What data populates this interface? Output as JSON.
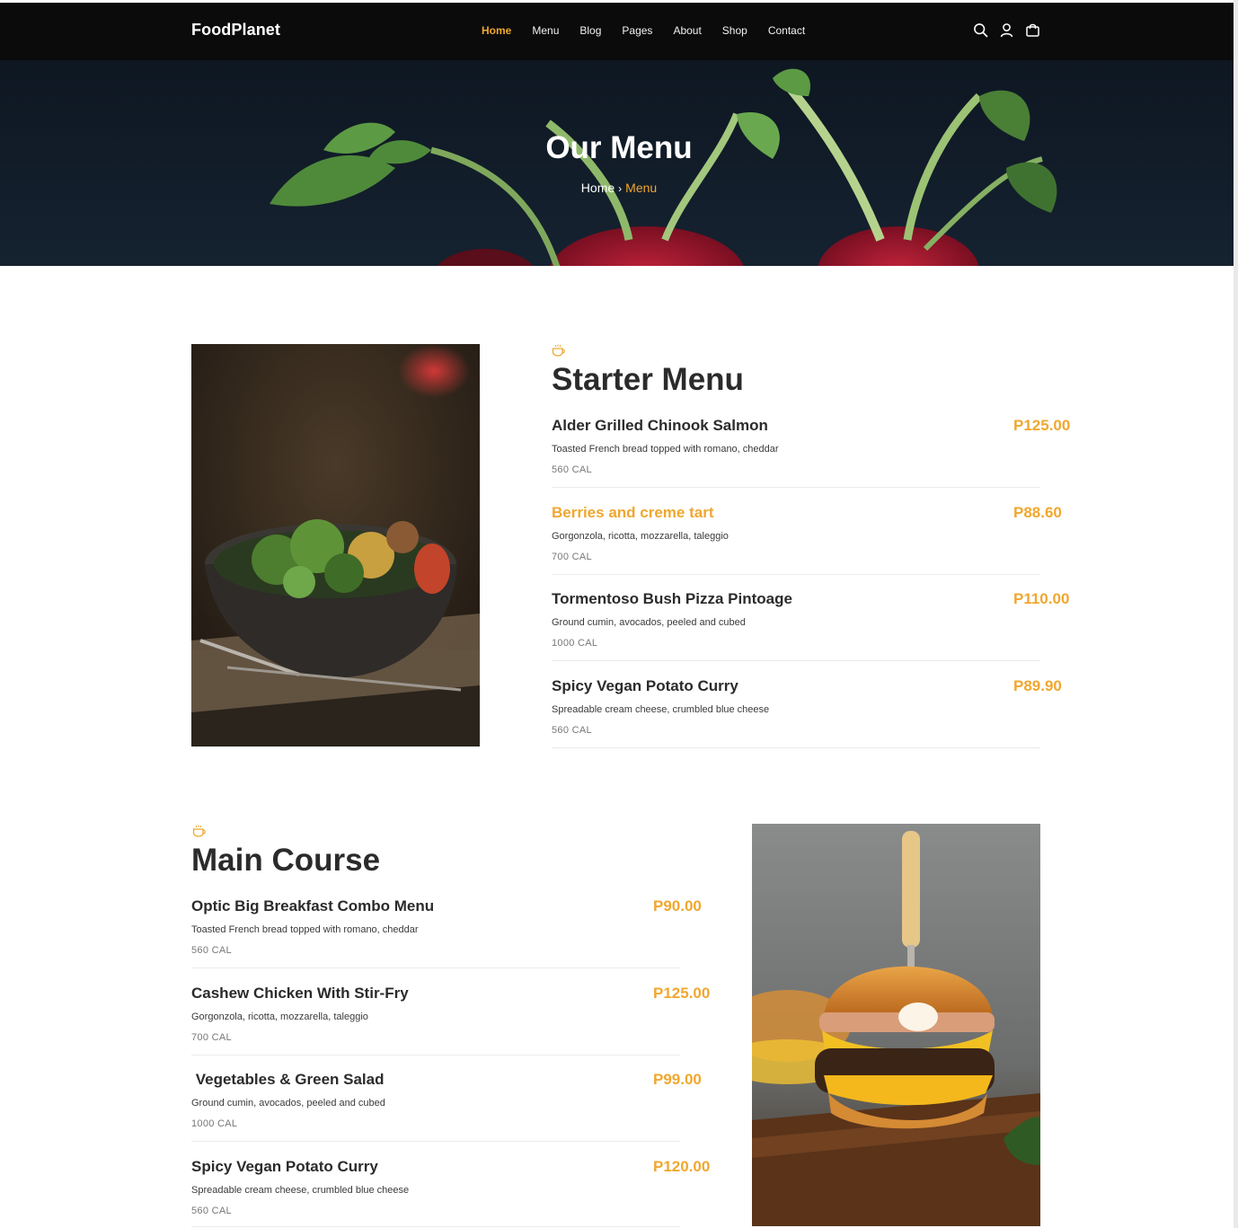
{
  "brand": {
    "name": "FoodPlanet",
    "accent": "#f0a72f",
    "navbar_bg": "#0b0b0b"
  },
  "nav": {
    "items": [
      {
        "label": "Home",
        "active": true
      },
      {
        "label": "Menu"
      },
      {
        "label": "Blog"
      },
      {
        "label": "Pages"
      },
      {
        "label": "About"
      },
      {
        "label": "Shop"
      },
      {
        "label": "Contact"
      }
    ],
    "icons": [
      "search-icon",
      "user-icon",
      "shopping-bag-icon"
    ]
  },
  "hero": {
    "title": "Our Menu",
    "breadcrumb": {
      "home": "Home",
      "separator": "›",
      "current": "Menu"
    }
  },
  "starter": {
    "icon": "coffee-cup-icon",
    "title": "Starter Menu",
    "items": [
      {
        "name": "Alder Grilled Chinook Salmon",
        "price": "P125.00",
        "desc": "Toasted French bread topped with romano, cheddar",
        "cal": "560 CAL"
      },
      {
        "name": "Berries and creme tart",
        "price": "P88.60",
        "desc": "Gorgonzola, ricotta, mozzarella, taleggio",
        "cal": "700 CAL",
        "highlight": true
      },
      {
        "name": "Tormentoso Bush Pizza Pintoage",
        "price": "P110.00",
        "desc": "Ground cumin, avocados, peeled and cubed",
        "cal": "1000 CAL"
      },
      {
        "name": "Spicy Vegan Potato Curry",
        "price": "P89.90",
        "desc": "Spreadable cream cheese, crumbled blue cheese",
        "cal": "560 CAL"
      }
    ]
  },
  "main_course": {
    "icon": "coffee-cup-icon",
    "title": "Main Course",
    "items": [
      {
        "name": "Optic Big Breakfast Combo Menu",
        "price": "P90.00",
        "desc": "Toasted French bread topped with romano, cheddar",
        "cal": "560 CAL"
      },
      {
        "name": "Cashew Chicken With Stir-Fry",
        "price": "P125.00",
        "desc": "Gorgonzola, ricotta, mozzarella, taleggio",
        "cal": "700 CAL"
      },
      {
        "name": " Vegetables & Green Salad",
        "price": "P99.00",
        "desc": "Ground cumin, avocados, peeled and cubed",
        "cal": "1000 CAL"
      },
      {
        "name": "Spicy Vegan Potato Curry",
        "price": "P120.00",
        "desc": "Spreadable cream cheese, crumbled blue cheese",
        "cal": "560 CAL"
      }
    ]
  }
}
